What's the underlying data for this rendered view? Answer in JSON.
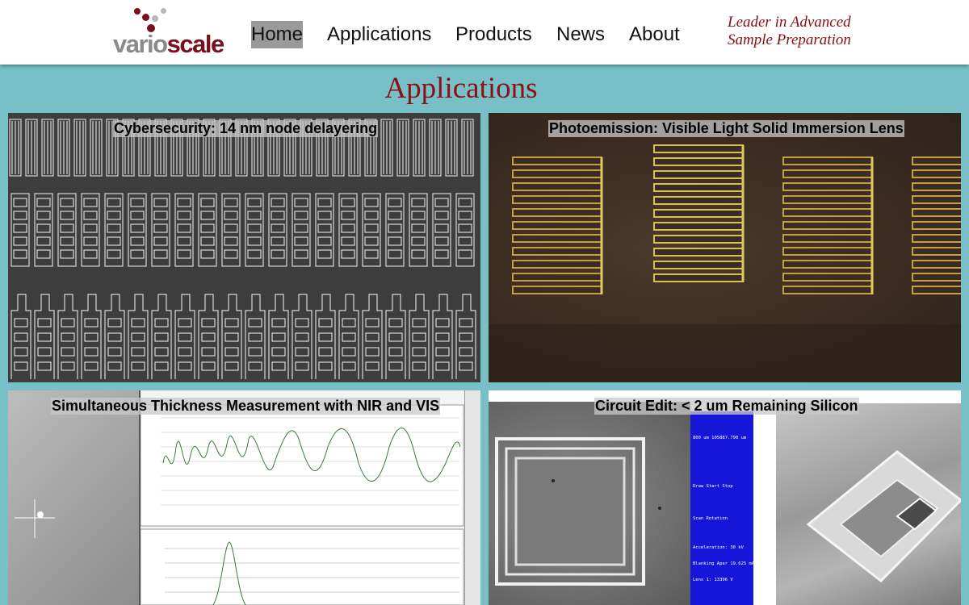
{
  "header": {
    "logo": {
      "part1": "vario",
      "part2": "scale"
    },
    "nav": [
      {
        "label": "Home"
      },
      {
        "label": "Applications"
      },
      {
        "label": "Products"
      },
      {
        "label": "News"
      },
      {
        "label": "About"
      }
    ],
    "tagline": {
      "line1": "Leader in Advanced",
      "line2": "Sample Preparation"
    }
  },
  "main": {
    "title": "Applications",
    "tiles": [
      {
        "caption": "Cybersecurity: 14 nm node delayering"
      },
      {
        "caption": "Photoemission: Visible Light Solid Immersion Lens"
      },
      {
        "caption": "Simultaneous Thickness Measurement with NIR and VIS"
      },
      {
        "caption": "Circuit Edit: < 2 um Remaining Silicon"
      }
    ]
  },
  "colors": {
    "page_background": "#78c0c8",
    "brand_maroon": "#7a0f1e",
    "title_red": "#8b1014",
    "active_nav": "#9a9a9a"
  }
}
